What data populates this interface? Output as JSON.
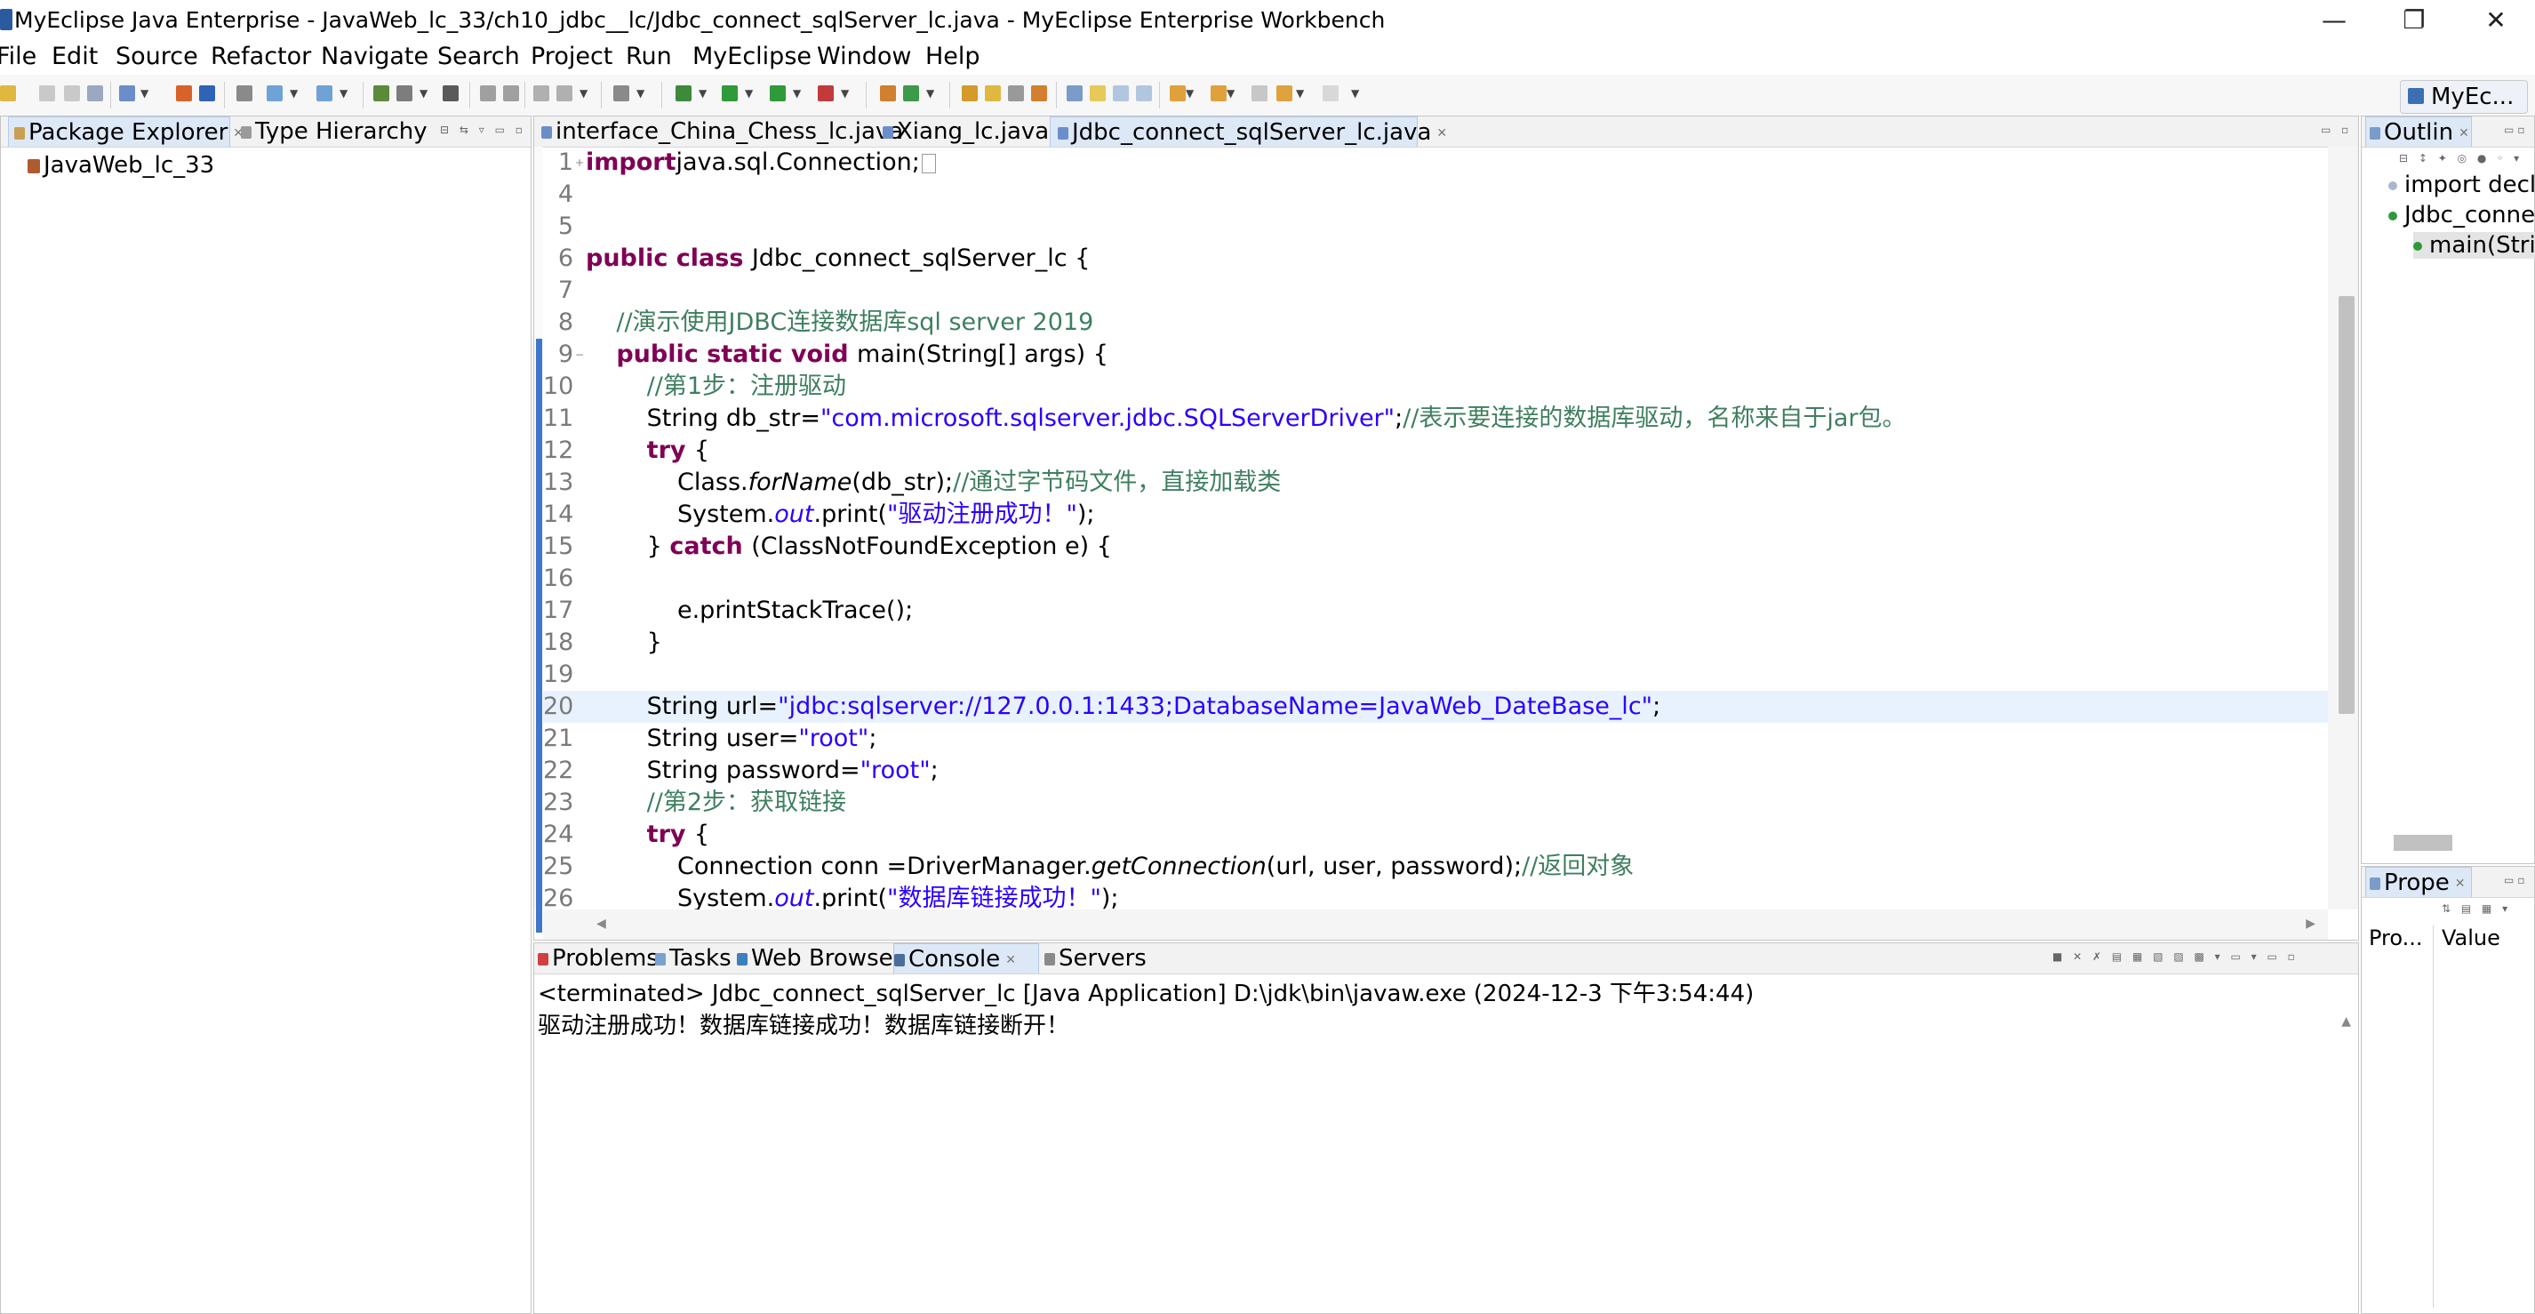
{
  "window": {
    "title": "MyEclipse Java Enterprise - JavaWeb_lc_33/ch10_jdbc__lc/Jdbc_connect_sqlServer_lc.java - MyEclipse Enterprise Workbench",
    "minimize": "—",
    "restore": "❐",
    "close": "✕"
  },
  "menu": [
    "File",
    "Edit",
    "Source",
    "Refactor",
    "Navigate",
    "Search",
    "Project",
    "Run",
    "MyEclipse",
    "Window",
    "Help"
  ],
  "perspective": {
    "label": "MyEc..."
  },
  "package_explorer": {
    "tabs": [
      "Package Explorer",
      "Type Hierarchy"
    ],
    "items": [
      "JavaWeb_lc_33"
    ]
  },
  "editor": {
    "tabs": [
      "interface_China_Chess_lc.java",
      "Xiang_lc.java",
      "Jdbc_connect_sqlServer_lc.java"
    ],
    "active_tab": 2,
    "current_line": 20,
    "lines": [
      {
        "n": "1",
        "fold": "+",
        "code": [
          [
            "kw",
            "import"
          ],
          [
            "",
            "java.sql.Connection;"
          ],
          [
            "box",
            ""
          ]
        ]
      },
      {
        "n": "4",
        "code": []
      },
      {
        "n": "5",
        "code": []
      },
      {
        "n": "6",
        "code": [
          [
            "kw",
            "public class "
          ],
          [
            "",
            "Jdbc_connect_sqlServer_lc {"
          ]
        ]
      },
      {
        "n": "7",
        "code": []
      },
      {
        "n": "8",
        "code": [
          [
            "",
            "    "
          ],
          [
            "cm",
            "//演示使用JDBC连接数据库sql server 2019"
          ]
        ]
      },
      {
        "n": "9",
        "fold": "-",
        "code": [
          [
            "",
            "    "
          ],
          [
            "kw",
            "public static void "
          ],
          [
            "",
            "main(String[] args) {"
          ]
        ]
      },
      {
        "n": "10",
        "code": [
          [
            "",
            "        "
          ],
          [
            "cm",
            "//第1步：注册驱动"
          ]
        ]
      },
      {
        "n": "11",
        "code": [
          [
            "",
            "        String db_str="
          ],
          [
            "str",
            "\"com.microsoft.sqlserver.jdbc.SQLServerDriver\""
          ],
          [
            "",
            ";"
          ],
          [
            "cm",
            "//表示要连接的数据库驱动，名称来自于jar包。"
          ]
        ]
      },
      {
        "n": "12",
        "code": [
          [
            "",
            "        "
          ],
          [
            "kw",
            "try "
          ],
          [
            "",
            "{"
          ]
        ]
      },
      {
        "n": "13",
        "code": [
          [
            "",
            "            Class."
          ],
          [
            "it",
            "forName"
          ],
          [
            "",
            "(db_str);"
          ],
          [
            "cm",
            "//通过字节码文件，直接加载类"
          ]
        ]
      },
      {
        "n": "14",
        "code": [
          [
            "",
            "            System."
          ],
          [
            "it str",
            "out"
          ],
          [
            "",
            ".print("
          ],
          [
            "str",
            "\"驱动注册成功！\""
          ],
          [
            "",
            ");"
          ]
        ]
      },
      {
        "n": "15",
        "code": [
          [
            "",
            "        } "
          ],
          [
            "kw",
            "catch "
          ],
          [
            "",
            "(ClassNotFoundException e) {"
          ]
        ]
      },
      {
        "n": "16",
        "code": []
      },
      {
        "n": "17",
        "code": [
          [
            "",
            "            e.printStackTrace();"
          ]
        ]
      },
      {
        "n": "18",
        "code": [
          [
            "",
            "        }"
          ]
        ]
      },
      {
        "n": "19",
        "code": []
      },
      {
        "n": "20",
        "code": [
          [
            "",
            "        String url="
          ],
          [
            "str",
            "\"jdbc:sqlserver://127.0.0.1:1433;DatabaseName=JavaWeb_DateBase_lc\""
          ],
          [
            "",
            ";"
          ]
        ]
      },
      {
        "n": "21",
        "code": [
          [
            "",
            "        String user="
          ],
          [
            "str",
            "\"root\""
          ],
          [
            "",
            ";"
          ]
        ]
      },
      {
        "n": "22",
        "code": [
          [
            "",
            "        String password="
          ],
          [
            "str",
            "\"root\""
          ],
          [
            "",
            ";"
          ]
        ]
      },
      {
        "n": "23",
        "code": [
          [
            "",
            "        "
          ],
          [
            "cm",
            "//第2步：获取链接"
          ]
        ]
      },
      {
        "n": "24",
        "code": [
          [
            "",
            "        "
          ],
          [
            "kw",
            "try "
          ],
          [
            "",
            "{"
          ]
        ]
      },
      {
        "n": "25",
        "code": [
          [
            "",
            "            Connection conn =DriverManager."
          ],
          [
            "it",
            "getConnection"
          ],
          [
            "",
            "(url, user, password);"
          ],
          [
            "cm",
            "//返回对象"
          ]
        ]
      },
      {
        "n": "26",
        "code": [
          [
            "",
            "            System."
          ],
          [
            "it str",
            "out"
          ],
          [
            "",
            ".print("
          ],
          [
            "str",
            "\"数据库链接成功！\""
          ],
          [
            "",
            ");"
          ]
        ]
      }
    ]
  },
  "bottom_panel": {
    "tabs": [
      "Problems",
      "Tasks",
      "Web Browser",
      "Console",
      "Servers"
    ],
    "active_tab": 3,
    "status": "<terminated> Jdbc_connect_sqlServer_lc [Java Application] D:\\jdk\\bin\\javaw.exe (2024-12-3 下午3:54:44)",
    "output": "驱动注册成功！数据库链接成功！数据库链接断开！"
  },
  "outline": {
    "tab": "Outlin",
    "items": [
      "import decla",
      "Jdbc_conne",
      "main(Strin"
    ]
  },
  "properties": {
    "tab": "Prope",
    "columns": [
      "Pro...",
      "Value"
    ]
  },
  "colors": {
    "keyword": "#7f0055",
    "string": "#2a00ff",
    "comment": "#3f7f5f",
    "current_line": "#e8f2fe",
    "active_tab": "#dde8f7"
  }
}
